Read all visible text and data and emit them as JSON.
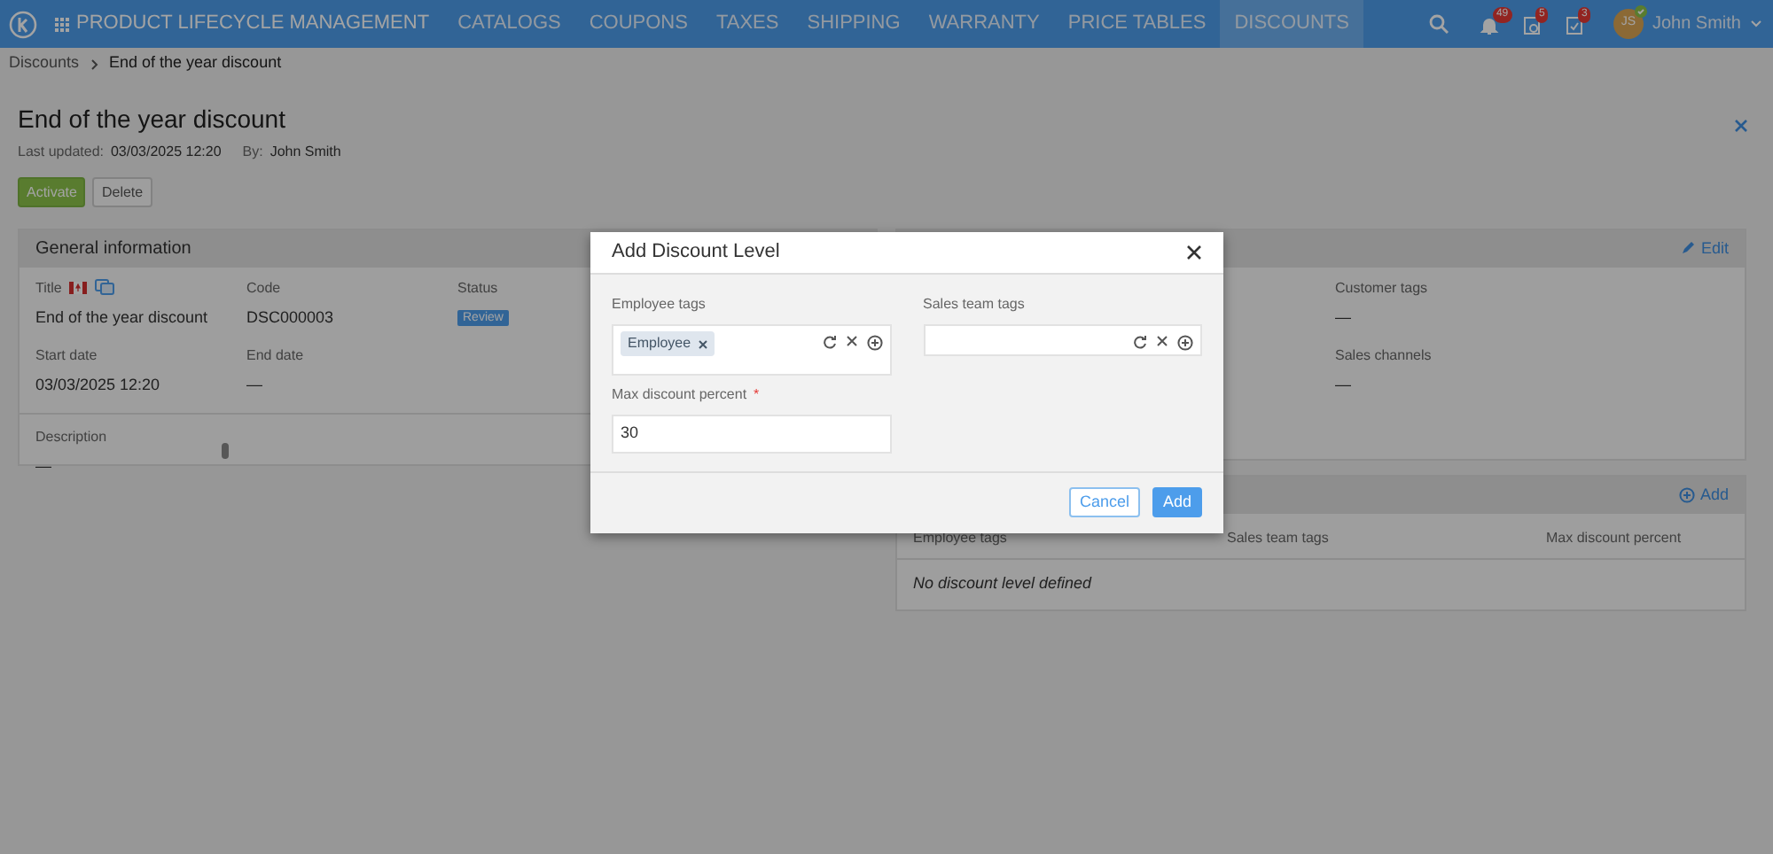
{
  "navbar": {
    "app_title": "PRODUCT LIFECYCLE MANAGEMENT",
    "menu": [
      {
        "label": "CATALOGS",
        "selected": false
      },
      {
        "label": "COUPONS",
        "selected": false
      },
      {
        "label": "TAXES",
        "selected": false
      },
      {
        "label": "SHIPPING",
        "selected": false
      },
      {
        "label": "WARRANTY",
        "selected": false
      },
      {
        "label": "PRICE TABLES",
        "selected": false
      },
      {
        "label": "DISCOUNTS",
        "selected": true
      }
    ],
    "notifications": [
      {
        "kind": "bell",
        "count": "49"
      },
      {
        "kind": "clipboard-clock",
        "count": "5"
      },
      {
        "kind": "clipboard-check",
        "count": "3"
      }
    ],
    "user": {
      "initials": "JS",
      "name": "John Smith"
    }
  },
  "breadcrumb": [
    "Discounts",
    "End of the year discount"
  ],
  "page": {
    "title": "End of the year discount",
    "last_updated_label": "Last updated:",
    "last_updated": "03/03/2025 12:20",
    "by_label": "By:",
    "by": "John Smith",
    "actions": [
      {
        "label": "Activate",
        "kind": "primary"
      },
      {
        "label": "Delete",
        "kind": "secondary"
      }
    ]
  },
  "general": {
    "title": "General information",
    "fields": [
      {
        "label": "Title",
        "value": "End of the year discount",
        "kind": "title"
      },
      {
        "label": "Code",
        "value": "DSC000003",
        "kind": "text"
      },
      {
        "label": "Status",
        "value": "Review",
        "kind": "badge"
      },
      {
        "label": "Start date",
        "value": "03/03/2025 12:20",
        "kind": "text"
      },
      {
        "label": "End date",
        "value": "—",
        "kind": "text"
      }
    ],
    "description": {
      "label": "Description",
      "value": "—"
    }
  },
  "targeting": {
    "edit_label": "Edit",
    "fields": [
      {
        "label": "Customer tags",
        "value": "—"
      },
      {
        "label": "Sales channels",
        "value": "—"
      }
    ]
  },
  "levels": {
    "add_label": "Add",
    "columns": [
      "Employee tags",
      "Sales team tags",
      "Max discount percent"
    ],
    "empty": "No discount level defined"
  },
  "modal": {
    "title": "Add Discount Level",
    "employee_tags": {
      "label": "Employee tags",
      "tags": [
        "Employee"
      ]
    },
    "sales_team_tags": {
      "label": "Sales team tags"
    },
    "max_discount": {
      "label": "Max discount percent",
      "required_mark": "*",
      "value": "30"
    },
    "buttons": [
      {
        "label": "Cancel",
        "kind": "secondary"
      },
      {
        "label": "Add",
        "kind": "primary"
      }
    ]
  }
}
